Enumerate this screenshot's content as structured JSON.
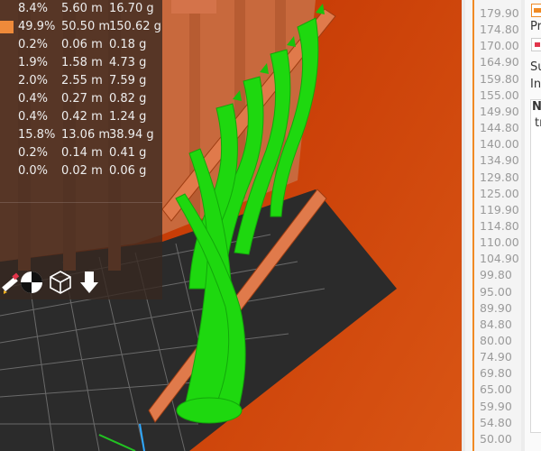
{
  "legend": {
    "rows": [
      {
        "percent": "8.4%",
        "length": "5.60 m",
        "weight": "16.70 g",
        "color": ""
      },
      {
        "percent": "49.9%",
        "length": "50.50 m",
        "weight": "150.62 g",
        "color": "#ef8a3a"
      },
      {
        "percent": "0.2%",
        "length": "0.06 m",
        "weight": "0.18 g",
        "color": ""
      },
      {
        "percent": "1.9%",
        "length": "1.58 m",
        "weight": "4.73 g",
        "color": ""
      },
      {
        "percent": "2.0%",
        "length": "2.55 m",
        "weight": "7.59 g",
        "color": ""
      },
      {
        "percent": "0.4%",
        "length": "0.27 m",
        "weight": "0.82 g",
        "color": ""
      },
      {
        "percent": "0.4%",
        "length": "0.42 m",
        "weight": "1.24 g",
        "color": ""
      },
      {
        "percent": "15.8%",
        "length": "13.06 m",
        "weight": "38.94 g",
        "color": ""
      },
      {
        "percent": "0.2%",
        "length": "0.14 m",
        "weight": "0.41 g",
        "color": ""
      },
      {
        "percent": "0.0%",
        "length": "0.02 m",
        "weight": "0.06 g",
        "color": ""
      }
    ],
    "tools": [
      {
        "icon": "pencil-ruler-icon"
      },
      {
        "icon": "center-of-gravity-icon"
      },
      {
        "icon": "wireframe-cube-icon"
      },
      {
        "icon": "download-arrow-icon"
      }
    ]
  },
  "layer_ruler": {
    "ticks": [
      "179.90",
      "174.80",
      "170.00",
      "164.90",
      "159.80",
      "155.00",
      "149.90",
      "144.80",
      "140.00",
      "134.90",
      "129.80",
      "125.00",
      "119.90",
      "114.80",
      "110.00",
      "104.90",
      "99.80",
      "95.00",
      "89.90",
      "84.80",
      "80.00",
      "74.90",
      "69.80",
      "65.00",
      "59.90",
      "54.80",
      "50.00"
    ]
  },
  "right_panel": {
    "print_label": "Pri",
    "support_label": "Su",
    "info_label": "Inf",
    "table_header": "Na",
    "table_cell": "tr"
  },
  "colors": {
    "accent_orange": "#f08a24",
    "support_green": "#1ed80f",
    "object_orange": "#c8693d",
    "background_red": "#c43d08"
  }
}
